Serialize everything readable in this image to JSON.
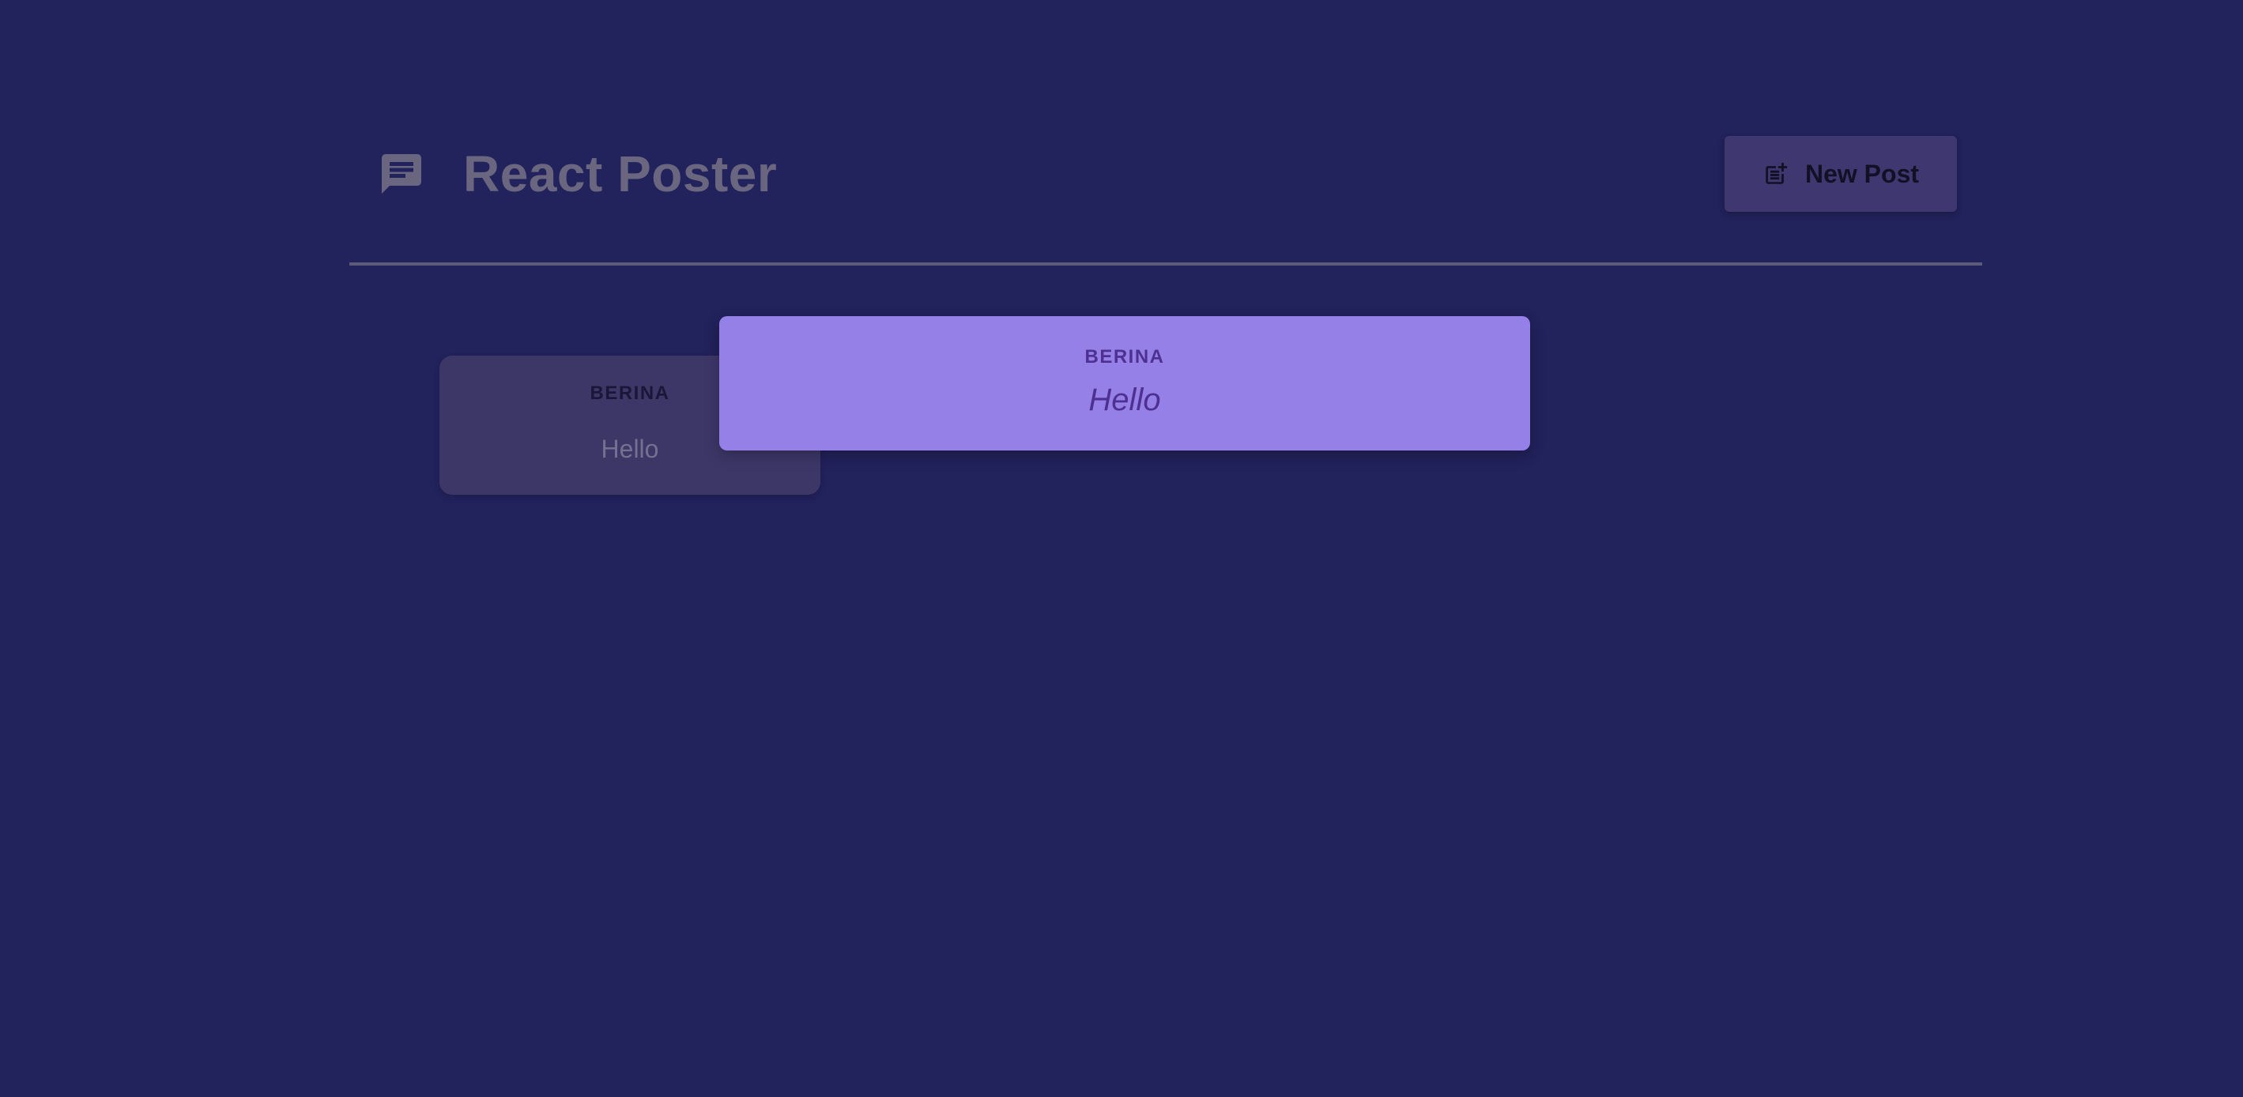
{
  "app": {
    "title": "React Poster",
    "logo_icon": "message-icon"
  },
  "header": {
    "new_post_label": "New Post",
    "new_post_icon": "post-add-icon"
  },
  "posts": [
    {
      "author": "BERINA",
      "body": "Hello"
    }
  ],
  "modal": {
    "author": "BERINA",
    "body": "Hello"
  },
  "colors": {
    "background": "#22225c",
    "modal_background": "#9580e8",
    "modal_text": "#4d3090",
    "card_background": "#3d3768",
    "button_background": "#3f3770",
    "title_color": "#6a6680"
  }
}
